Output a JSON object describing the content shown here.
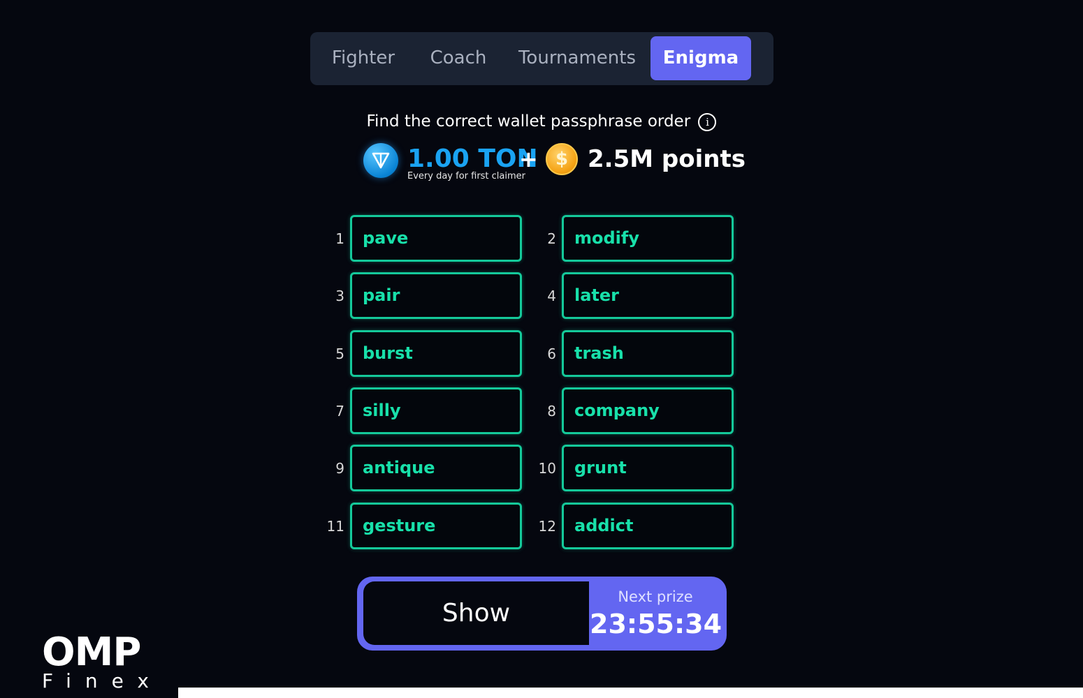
{
  "tabs": [
    {
      "label": "Fighter"
    },
    {
      "label": "Coach"
    },
    {
      "label": "Tournaments"
    },
    {
      "label": "Enigma",
      "active": true
    }
  ],
  "instruction": "Find the correct wallet passphrase order",
  "reward": {
    "ton_amount": "1.00 TON",
    "ton_subtitle": "Every day for first claimer",
    "plus": "+",
    "coin_symbol": "$",
    "points": "2.5M points"
  },
  "words": [
    {
      "num": "1",
      "word": "pave"
    },
    {
      "num": "2",
      "word": "modify"
    },
    {
      "num": "3",
      "word": "pair"
    },
    {
      "num": "4",
      "word": "later"
    },
    {
      "num": "5",
      "word": "burst"
    },
    {
      "num": "6",
      "word": "trash"
    },
    {
      "num": "7",
      "word": "silly"
    },
    {
      "num": "8",
      "word": "company"
    },
    {
      "num": "9",
      "word": "antique"
    },
    {
      "num": "10",
      "word": "grunt"
    },
    {
      "num": "11",
      "word": "gesture"
    },
    {
      "num": "12",
      "word": "addict"
    }
  ],
  "show_button": {
    "label": "Show"
  },
  "next_prize": {
    "label": "Next prize",
    "time": "23:55:34"
  },
  "watermark": {
    "main": "OMP",
    "sub": "Finex"
  },
  "colors": {
    "accent": "#6366f1",
    "word_border": "#14c99a",
    "ton_blue": "#1aa3f2",
    "background": "#05070f"
  }
}
